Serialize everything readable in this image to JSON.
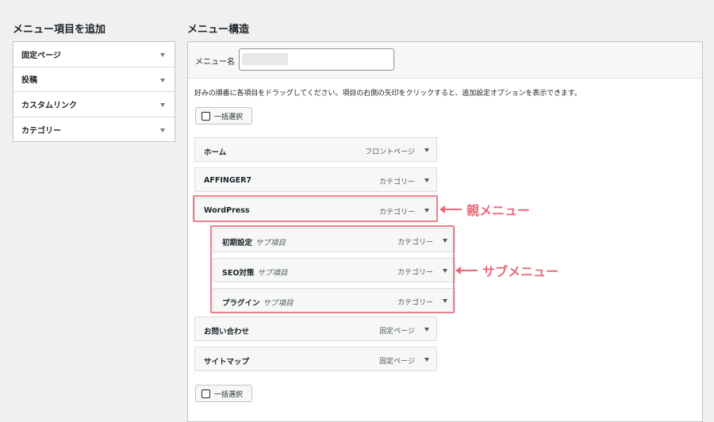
{
  "left": {
    "heading": "メニュー項目を追加",
    "items": [
      {
        "label": "固定ページ"
      },
      {
        "label": "投稿"
      },
      {
        "label": "カスタムリンク"
      },
      {
        "label": "カテゴリー"
      }
    ]
  },
  "right": {
    "heading": "メニュー構造",
    "name_label": "メニュー名",
    "name_value": "",
    "instructions": "好みの順番に各項目をドラッグしてください。項目の右側の矢印をクリックすると、追加設定オプションを表示できます。",
    "bulk_select_label": "一括選択",
    "items": [
      {
        "title": "ホーム",
        "subtitle": "",
        "type": "フロントページ"
      },
      {
        "title": "AFFINGER7",
        "subtitle": "",
        "type": "カテゴリー"
      },
      {
        "title": "WordPress",
        "subtitle": "",
        "type": "カテゴリー"
      }
    ],
    "sub_items": [
      {
        "title": "初期設定",
        "subtitle": "サブ項目",
        "type": "カテゴリー"
      },
      {
        "title": "SEO対策",
        "subtitle": "サブ項目",
        "type": "カテゴリー"
      },
      {
        "title": "プラグイン",
        "subtitle": "サブ項目",
        "type": "カテゴリー"
      }
    ],
    "after_items": [
      {
        "title": "お問い合わせ",
        "subtitle": "",
        "type": "固定ページ"
      },
      {
        "title": "サイトマップ",
        "subtitle": "",
        "type": "固定ページ"
      }
    ]
  },
  "annotations": {
    "parent_menu": "親メニュー",
    "sub_menu": "サブメニュー"
  },
  "colors": {
    "annotation": "#e8697a",
    "highlight_border": "#ec7f8c"
  }
}
